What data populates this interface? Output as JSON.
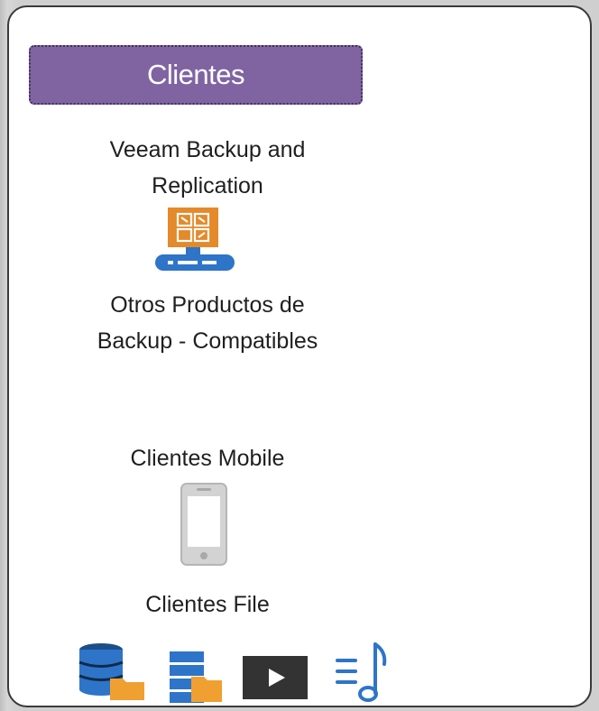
{
  "header": {
    "title": "Clientes"
  },
  "items": {
    "veeam": {
      "line1": "Veeam Backup and",
      "line2": "Replication",
      "icon": "veeam-server-icon",
      "icon_color": "#e48a2a",
      "base_color": "#2e74c9"
    },
    "otros": {
      "line1": "Otros Productos de",
      "line2": "Backup - Compatibles"
    },
    "mobile": {
      "label": "Clientes Mobile",
      "icon": "mobile-phone-icon",
      "icon_color": "#c8c8c8"
    },
    "file": {
      "label": "Clientes File",
      "icons": [
        "database-folder-icon",
        "server-folder-icon",
        "video-play-icon",
        "music-playlist-icon"
      ],
      "colors": {
        "blue": "#2e74c9",
        "dark_blue": "#1c4f8a",
        "orange": "#f0a030",
        "dark": "#333333"
      }
    }
  },
  "colors": {
    "accent": "#8064a2",
    "border": "#3a3a3a"
  }
}
